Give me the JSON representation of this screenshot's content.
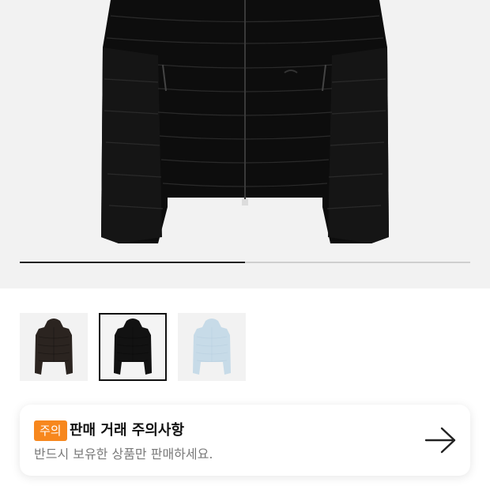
{
  "gallery": {
    "progress": 0.5,
    "thumbnails": [
      {
        "color": "brown",
        "hex": "#2b2420",
        "selected": false
      },
      {
        "color": "black",
        "hex": "#121212",
        "selected": true
      },
      {
        "color": "light-blue",
        "hex": "#c7dbe8",
        "selected": false
      }
    ]
  },
  "notice": {
    "badge": "주의",
    "title": "판매 거래 주의사항",
    "subtitle": "반드시 보유한 상품만 판매하세요.",
    "arrow_icon": "arrow-right-icon",
    "badge_color": "#f7871d"
  }
}
